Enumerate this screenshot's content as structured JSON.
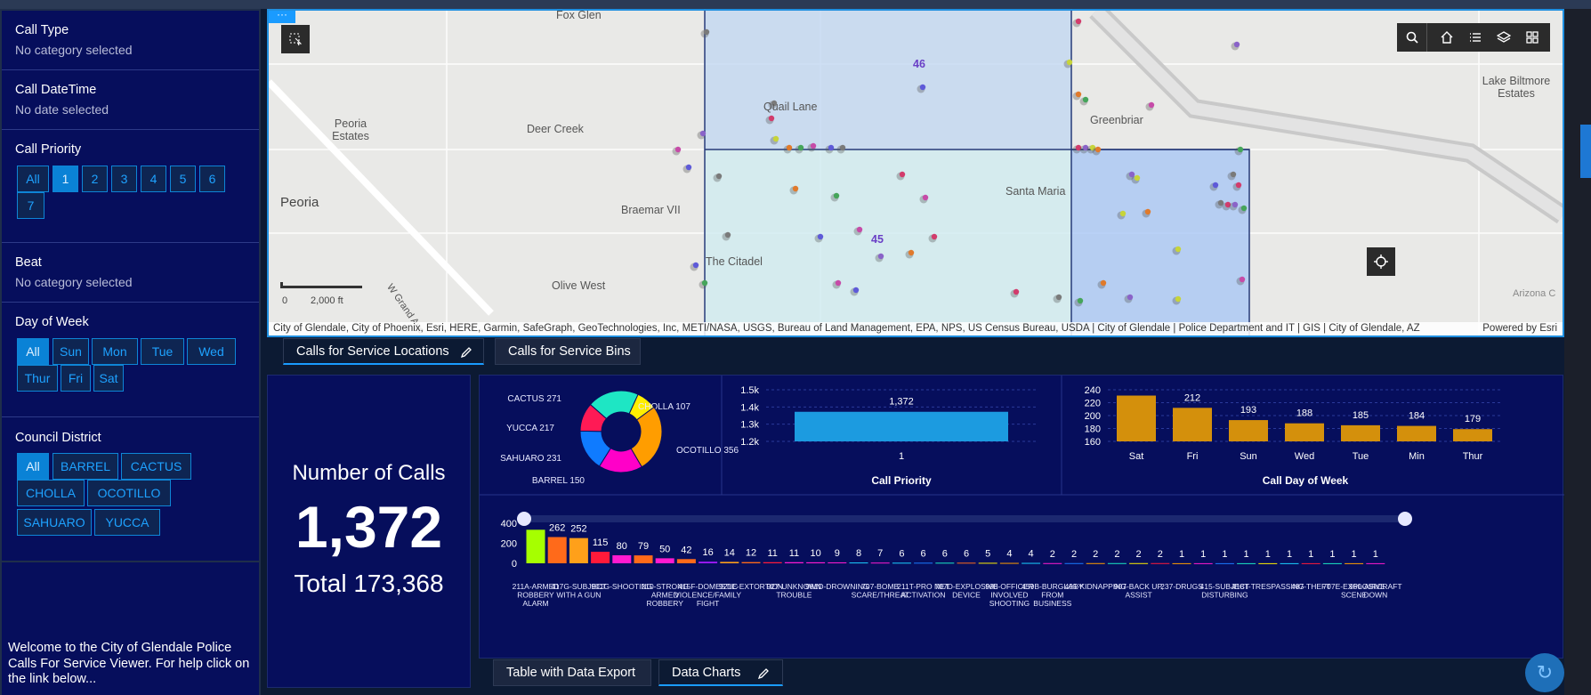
{
  "filters": {
    "call_type": {
      "title": "Call Type",
      "subtitle": "No category selected"
    },
    "call_datetime": {
      "title": "Call DateTime",
      "subtitle": "No date selected"
    },
    "call_priority": {
      "title": "Call Priority",
      "options": [
        "All",
        "1",
        "2",
        "3",
        "4",
        "5",
        "6",
        "7"
      ],
      "selected": "1"
    },
    "beat": {
      "title": "Beat",
      "subtitle": "No category selected"
    },
    "day_of_week": {
      "title": "Day of Week",
      "options": [
        "All",
        "Sun",
        "Mon",
        "Tue",
        "Wed",
        "Thur",
        "Fri",
        "Sat"
      ],
      "selected": "All"
    },
    "council_district": {
      "title": "Council District",
      "options": [
        "All",
        "BARREL",
        "CACTUS",
        "CHOLLA",
        "OCOTILLO",
        "SAHUARO",
        "YUCCA"
      ],
      "selected": "All"
    }
  },
  "welcome_text": "Welcome to the City of Glendale Police Calls For Service Viewer.  For help click on the link below...",
  "map": {
    "place_labels": [
      "Fox Glen",
      "Quail Lane",
      "Peoria Estates",
      "Deer Creek",
      "Greenbriar",
      "Lake Biltmore Estates",
      "Santa Maria",
      "Peoria",
      "Braemar VII",
      "The Citadel",
      "Olive West",
      "W Grand Ave",
      "Arizona C"
    ],
    "beat_labels": [
      "46",
      "45"
    ],
    "scale_labels": [
      "0",
      "2,000 ft"
    ],
    "attribution": "City of Glendale, City of Phoenix, Esri, HERE, Garmin, SafeGraph, GeoTechnologies, Inc, METI/NASA, USGS, Bureau of Land Management, EPA, NPS, US Census Bureau, USDA | City of Glendale | Police Department and IT | GIS | City of Glendale, AZ",
    "powered_by": "Powered by Esri",
    "tool_icons": [
      "select-icon",
      "search-icon",
      "home-icon",
      "list-icon",
      "layers-icon",
      "grid-icon",
      "locate-icon",
      "more-icon"
    ]
  },
  "map_tabs": [
    "Calls for Service Locations",
    "Calls for Service Bins"
  ],
  "number_panel": {
    "title": "Number of Calls",
    "value": "1,372",
    "total": "Total 173,368"
  },
  "bottom_tabs": [
    "Table with Data Export",
    "Data Charts"
  ],
  "colors": {
    "accent": "#1a9bff",
    "panel": "#060e5c",
    "bar_blue": "#1c9be0",
    "bar_gold": "#d4900c"
  },
  "chart_data": [
    {
      "type": "pie",
      "title": "",
      "categories": [
        "CACTUS",
        "CHOLLA",
        "OCOTILLO",
        "SAHUARO",
        "YUCCA",
        "BARREL"
      ],
      "values": [
        271,
        107,
        356,
        231,
        217,
        150
      ],
      "labels": [
        "CACTUS 271",
        "CHOLLA 107",
        "OCOTILLO 356",
        "SAHUARO 231",
        "YUCCA 217",
        "BARREL 150"
      ],
      "colors": [
        "#1ee6c4",
        "#ffee00",
        "#ff9d00",
        "#ff00c8",
        "#0f7bff",
        "#ff1a55"
      ]
    },
    {
      "type": "bar",
      "title": "Call Priority",
      "categories": [
        "1"
      ],
      "values": [
        1372
      ],
      "data_labels": [
        "1,372"
      ],
      "ylim": [
        1200,
        1500
      ],
      "yticks": [
        "1.2k",
        "1.3k",
        "1.4k",
        "1.5k"
      ],
      "color": "#1c9be0"
    },
    {
      "type": "bar",
      "title": "Call Day of Week",
      "categories": [
        "Sat",
        "Fri",
        "Sun",
        "Wed",
        "Tue",
        "Min",
        "Thur"
      ],
      "values": [
        231,
        212,
        193,
        188,
        185,
        184,
        179
      ],
      "data_labels": [
        "",
        "212",
        "193",
        "188",
        "185",
        "184",
        "179"
      ],
      "ylim": [
        160,
        240
      ],
      "yticks": [
        "160",
        "180",
        "200",
        "220",
        "240"
      ],
      "color": "#d4900c"
    },
    {
      "type": "bar",
      "title": "",
      "categories": [
        "211A-ARMED ROBBERY ALARM",
        "417G-SUBJECT WITH A GUN",
        "901G-SHOOTING",
        "210-STRONG ARMED ROBBERY",
        "415F-DOMESTIC VIOLENCE/FAMILY FIGHT",
        "921E-EXTORTION",
        "927-UNKNOWN TROUBLE",
        "981D-DROWNING",
        "707-BOMB SCARE/THREAT",
        "211T-PRO NET ACTIVATION",
        "707D-EXPLOSIVE DEVICE",
        "998-OFFICER INVOLVED SHOOTING",
        "459B-BURGLARY FROM BUSINESS",
        "491-KIDNAPPING",
        "907-BACK UP, ASSIST",
        "237-DRUGS",
        "415-SUBJECT DISTURBING",
        "418T-TRESPASSING",
        "487-THEFT",
        "707E-EXPLOSIVE SCENE",
        "960-AIRCRAFT DOWN"
      ],
      "values": [
        335,
        262,
        252,
        115,
        80,
        79,
        50,
        42,
        16,
        14,
        12,
        11,
        11,
        10,
        9,
        8,
        7,
        6,
        6,
        6,
        6,
        5,
        4,
        4,
        2,
        2,
        2,
        2,
        2,
        2,
        1,
        1,
        1,
        1,
        1,
        1,
        1,
        1,
        1,
        1
      ],
      "data_labels": [
        "",
        "262",
        "252",
        "115",
        "80",
        "79",
        "50",
        "42",
        "16",
        "14",
        "12",
        "11",
        "11",
        "10",
        "9",
        "8",
        "7",
        "6",
        "6",
        "6",
        "6",
        "5",
        "4",
        "4",
        "2",
        "2",
        "2",
        "2",
        "2",
        "2",
        "1",
        "1",
        "1",
        "1",
        "1",
        "1",
        "1",
        "1",
        "1",
        "1"
      ],
      "ylim": [
        0,
        400
      ],
      "yticks": [
        "0",
        "200",
        "400"
      ],
      "colors": [
        "#a6ff00",
        "#ff6a1a",
        "#ffa01a",
        "#ff1a3a",
        "#ff1ad0",
        "#ff6a1a",
        "#ff1ad0",
        "#ff6a1a",
        "#a21aff",
        "#ffa01a",
        "#ff6a1a",
        "#ff1a3a",
        "#ff1ad0",
        "#ff1ad0",
        "#ff1ad0",
        "#1ad0ff",
        "#ff1ad0",
        "#1ad0ff",
        "#1a7aff",
        "#1ae6c4",
        "#ff6a1a",
        "#ffee00",
        "#ff9d00",
        "#1ad0ff",
        "#ff1ad0",
        "#1a7aff",
        "#ff9d00",
        "#1ae6c4",
        "#ffee00",
        "#ff1a3a",
        "#ff9d00",
        "#ff1ad0",
        "#1a7aff",
        "#1ae6c4",
        "#ffee00",
        "#1ad0ff",
        "#ff1a3a",
        "#1ae6c4",
        "#ff9d00",
        "#ff1ad0"
      ]
    }
  ]
}
